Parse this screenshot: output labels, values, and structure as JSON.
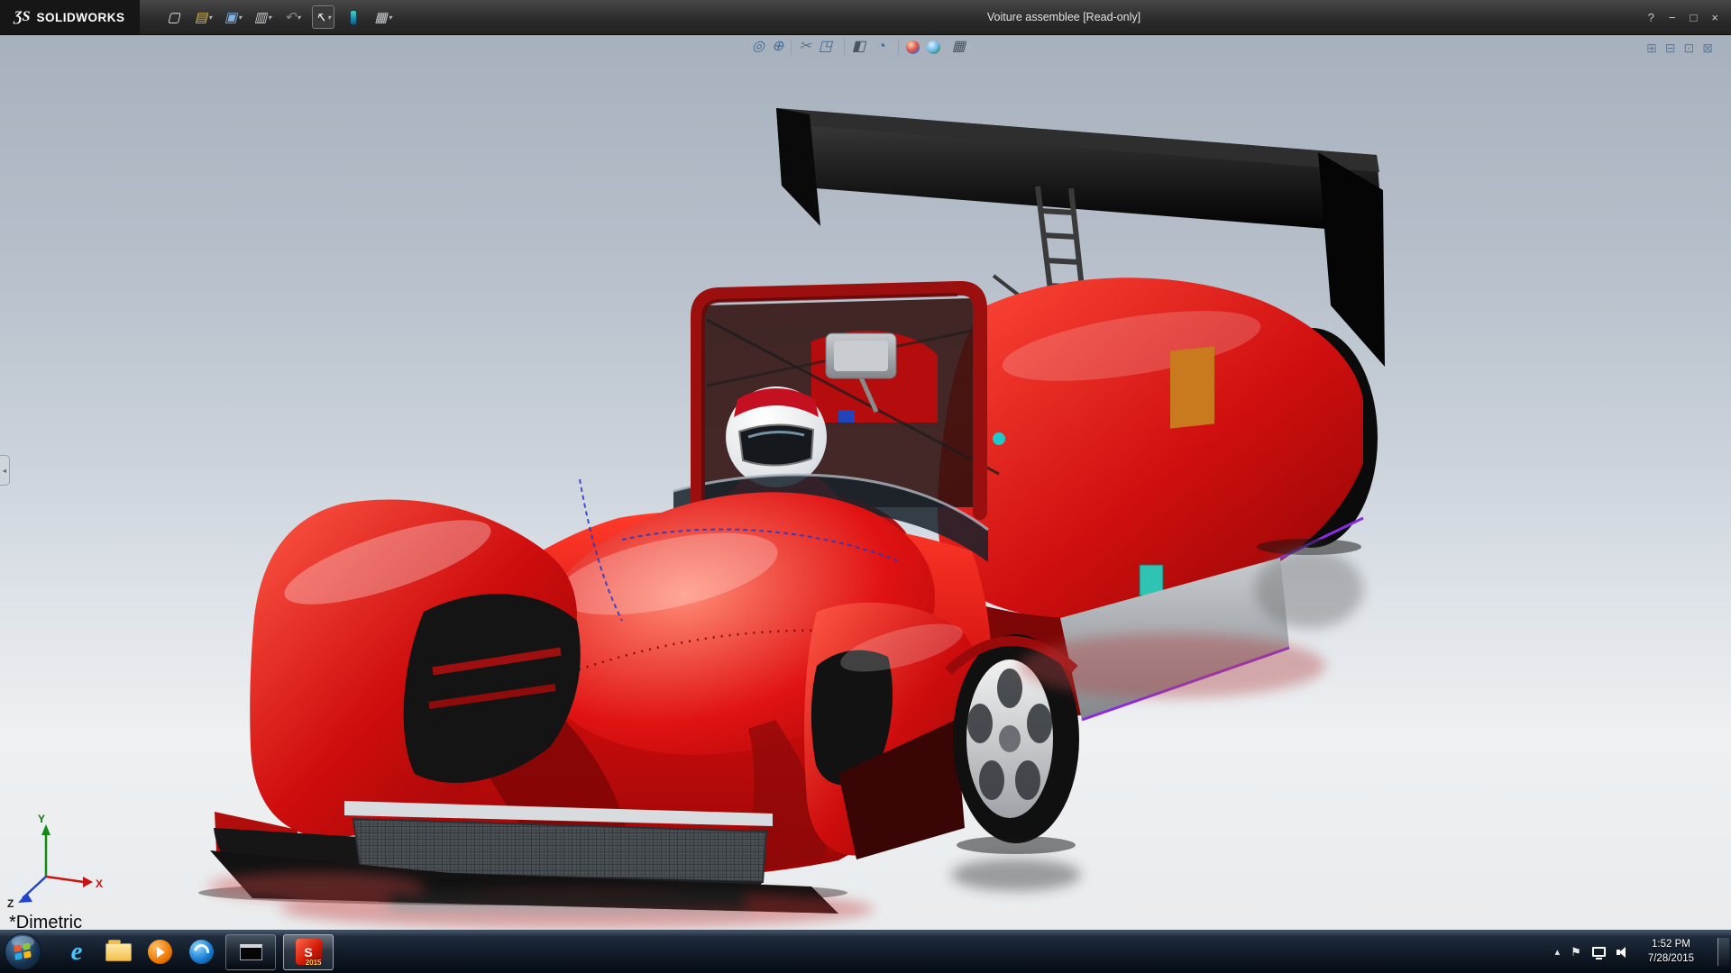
{
  "ui": {
    "caret": "▾"
  },
  "titlebar": {
    "brand_mark": "ƷS",
    "brand": "SOLIDWORKS",
    "title": "Voiture assemblee [Read-only]",
    "tools": [
      {
        "name": "new-document",
        "glyph": "▢"
      },
      {
        "name": "open",
        "glyph": "▤",
        "dropdown": true
      },
      {
        "name": "save",
        "glyph": "▣",
        "dropdown": true
      },
      {
        "name": "print",
        "glyph": "▥",
        "dropdown": true
      },
      {
        "name": "undo",
        "glyph": "↶",
        "dropdown": true
      },
      {
        "name": "select",
        "glyph": "↖",
        "dropdown": true
      },
      {
        "name": "rebuild"
      },
      {
        "name": "options",
        "glyph": "▦",
        "dropdown": true
      }
    ],
    "window_controls": [
      {
        "name": "help",
        "glyph": "?"
      },
      {
        "name": "minimize",
        "glyph": "−"
      },
      {
        "name": "maximize",
        "glyph": "□"
      },
      {
        "name": "close",
        "glyph": "×"
      }
    ]
  },
  "headsup": {
    "icons": [
      {
        "name": "zoom-to-fit",
        "glyph": "◎"
      },
      {
        "name": "zoom-to-area",
        "glyph": "⊕"
      },
      {
        "name": "section-view",
        "glyph": "✂"
      },
      {
        "name": "view-orientation",
        "glyph": "◳",
        "dropdown": true
      },
      {
        "name": "display-style",
        "glyph": "◧",
        "dropdown": true
      },
      {
        "name": "hide-show-items",
        "glyph": "◔",
        "dropdown": true
      },
      {
        "name": "edit-appearance"
      },
      {
        "name": "apply-scene",
        "dropdown": true
      },
      {
        "name": "view-settings",
        "glyph": "▦",
        "dropdown": true
      }
    ]
  },
  "doc_controls": [
    {
      "name": "doc-restore",
      "glyph": "⊞"
    },
    {
      "name": "doc-minimize",
      "glyph": "⊟"
    },
    {
      "name": "doc-maximize",
      "glyph": "⊡"
    },
    {
      "name": "doc-close",
      "glyph": "⊠"
    }
  ],
  "viewport": {
    "view_label": "*Dimetric",
    "edge_tab_glyph": "◂",
    "triad": {
      "x": "X",
      "y": "Y",
      "z": "Z"
    }
  },
  "taskbar": {
    "ie_letter": "e",
    "solidworks": {
      "letters": "S",
      "year": "2015"
    },
    "tray": {
      "chevron": "▴",
      "flag": "⚑",
      "time": "1:52 PM",
      "date": "7/28/2015"
    }
  },
  "colors": {
    "car_red": "#d40f0f",
    "wing_black": "#0b0b0b",
    "titlebar_bg": "#2e2e2e",
    "taskbar_bg": "#101823",
    "viewport_top": "#a7b1bd",
    "viewport_bottom": "#e9ecee",
    "accent_purple": "#8a2be2"
  }
}
